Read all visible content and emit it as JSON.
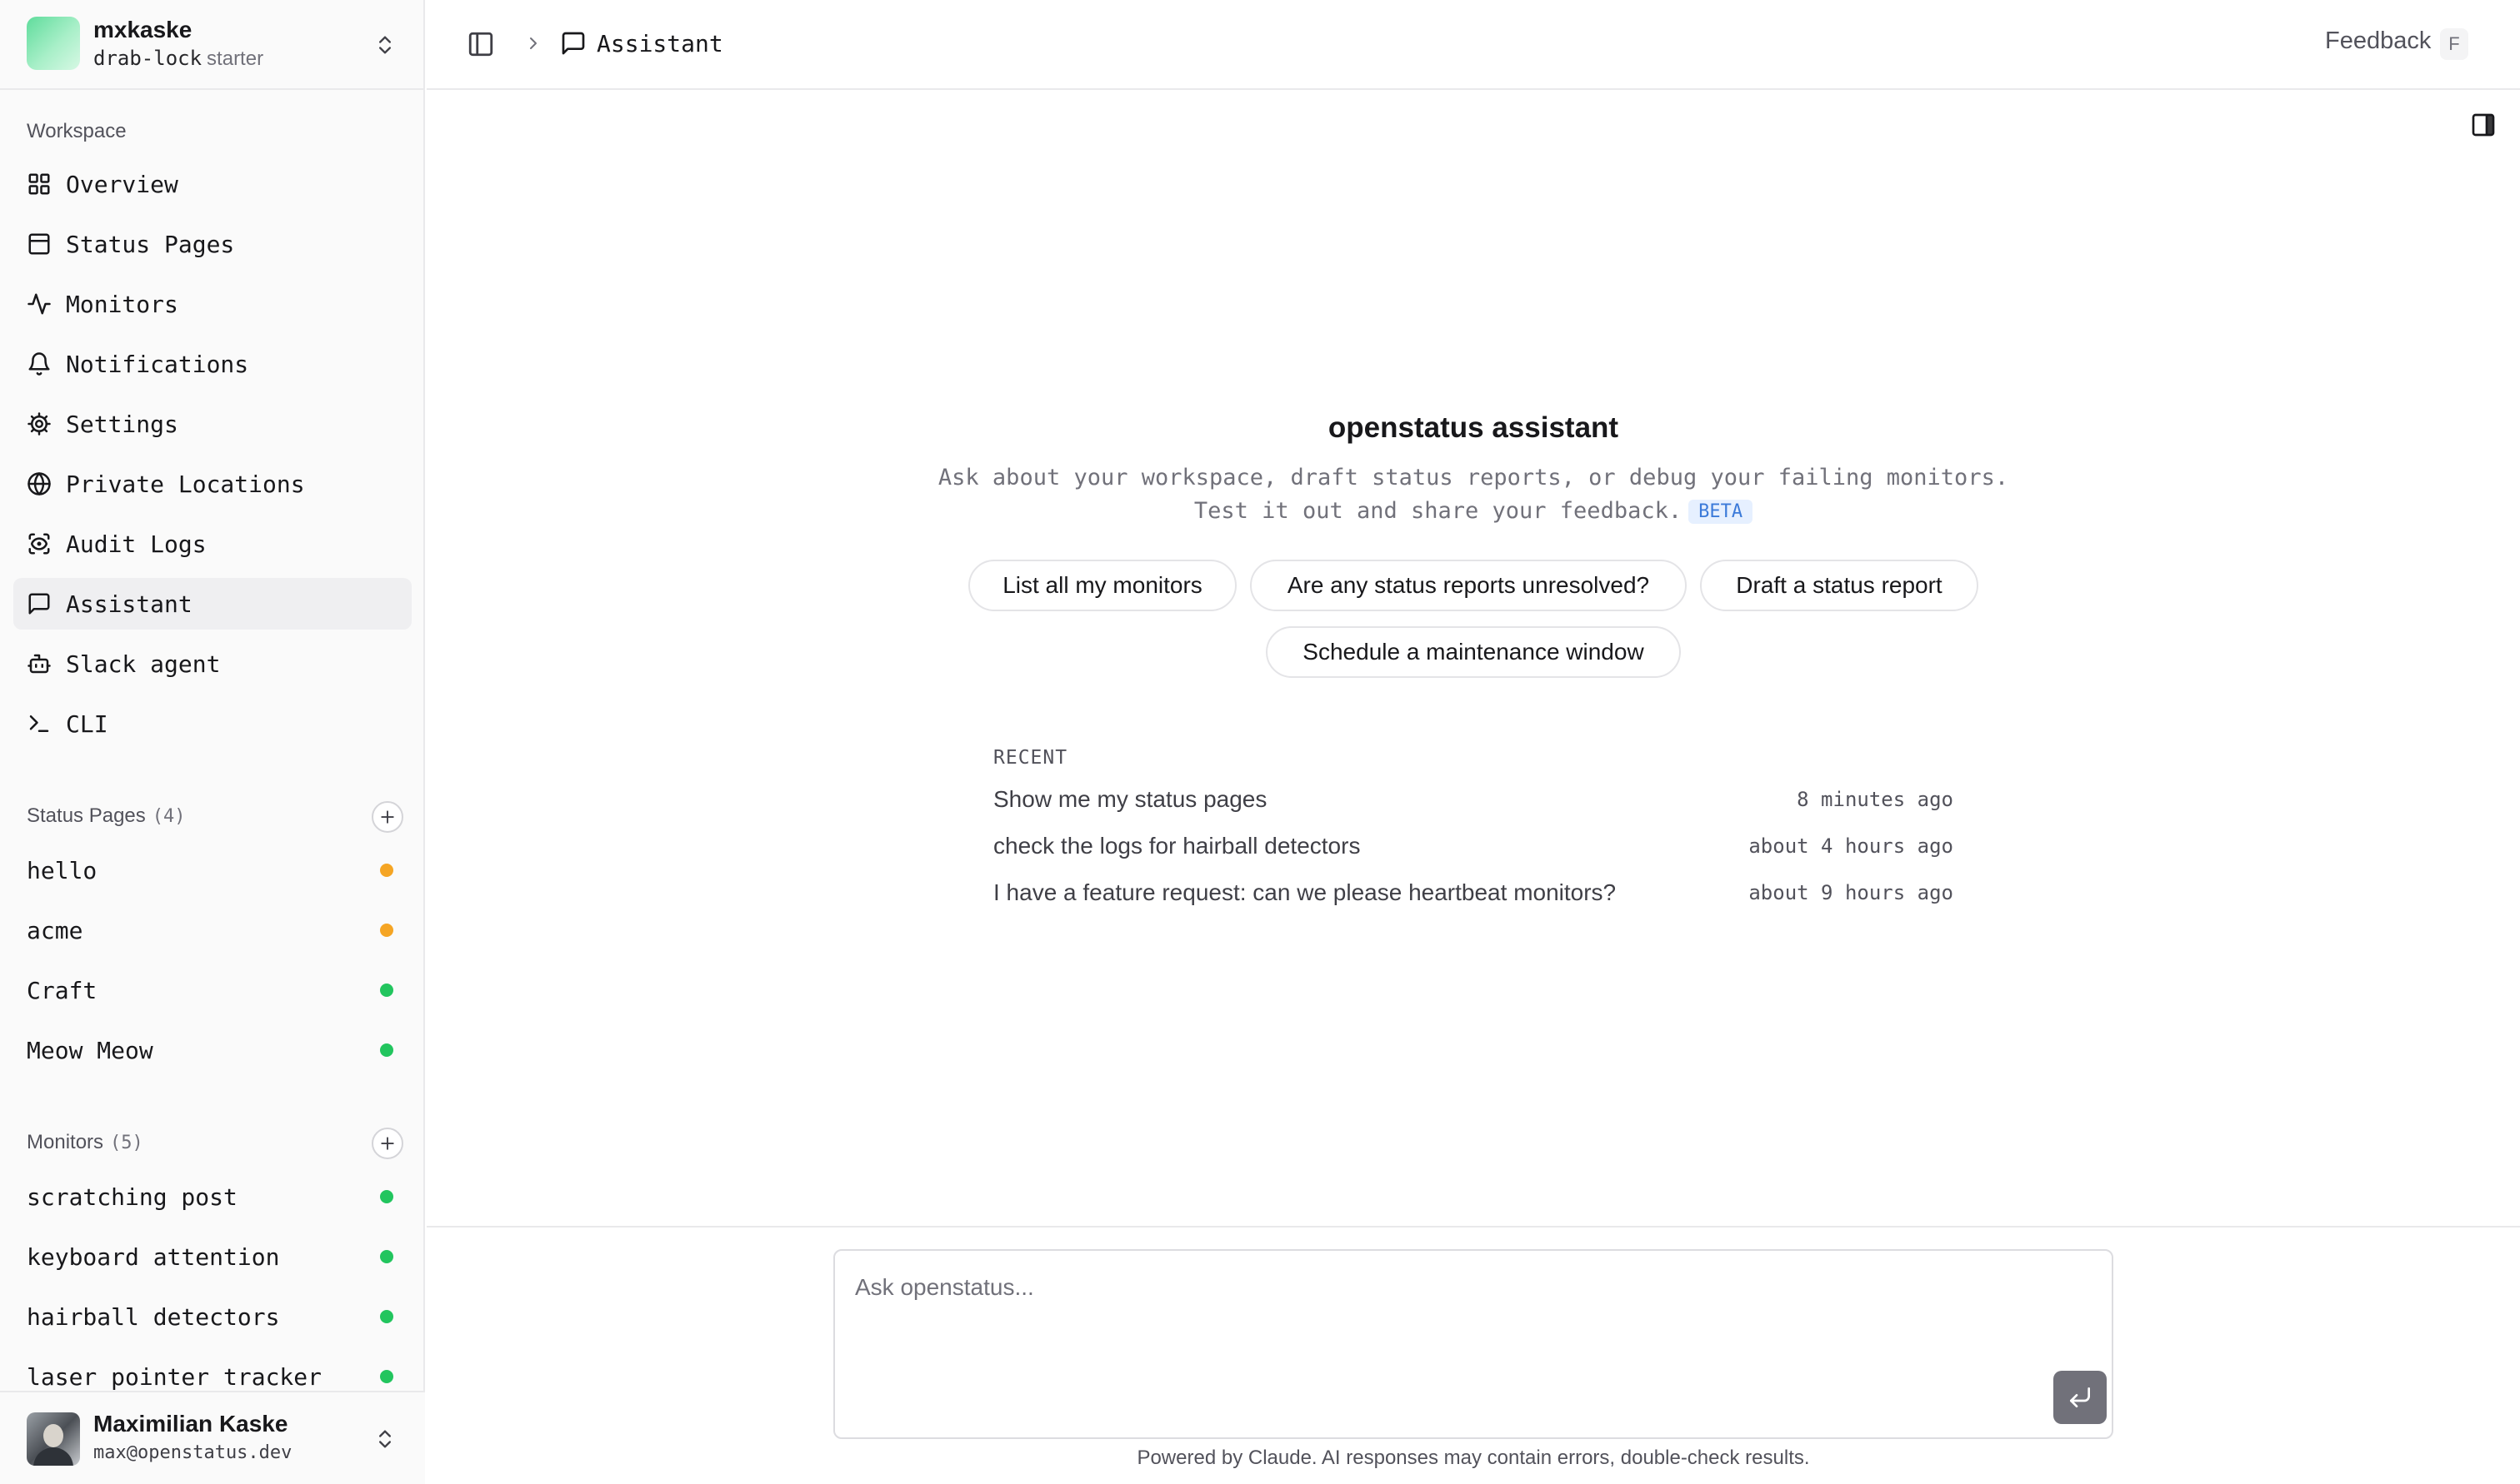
{
  "team": {
    "name": "mxkaske",
    "slug": "drab-lock",
    "plan": "starter"
  },
  "workspace": {
    "label": "Workspace",
    "items": [
      {
        "label": "Overview",
        "icon": "layout-grid-icon"
      },
      {
        "label": "Status Pages",
        "icon": "panel-top-icon"
      },
      {
        "label": "Monitors",
        "icon": "activity-icon"
      },
      {
        "label": "Notifications",
        "icon": "bell-icon"
      },
      {
        "label": "Settings",
        "icon": "cog-icon"
      },
      {
        "label": "Private Locations",
        "icon": "globe-icon"
      },
      {
        "label": "Audit Logs",
        "icon": "scan-eye-icon"
      },
      {
        "label": "Assistant",
        "icon": "message-square-icon",
        "active": true
      },
      {
        "label": "Slack agent",
        "icon": "bot-icon"
      },
      {
        "label": "CLI",
        "icon": "terminal-icon"
      }
    ]
  },
  "status_pages": {
    "label": "Status Pages",
    "count": "(4)",
    "items": [
      {
        "label": "hello",
        "status_color": "#f5a524"
      },
      {
        "label": "acme",
        "status_color": "#f5a524"
      },
      {
        "label": "Craft",
        "status_color": "#22c55e"
      },
      {
        "label": "Meow Meow",
        "status_color": "#22c55e"
      }
    ]
  },
  "monitors": {
    "label": "Monitors",
    "count": "(5)",
    "items": [
      {
        "label": "scratching post",
        "status_color": "#22c55e"
      },
      {
        "label": "keyboard attention",
        "status_color": "#22c55e"
      },
      {
        "label": "hairball detectors",
        "status_color": "#22c55e"
      },
      {
        "label": "laser pointer tracker",
        "status_color": "#22c55e"
      }
    ]
  },
  "user": {
    "name": "Maximilian Kaske",
    "email": "max@openstatus.dev"
  },
  "topbar": {
    "breadcrumb": "Assistant",
    "feedback_label": "Feedback",
    "feedback_shortcut": "F"
  },
  "assistant": {
    "title": "openstatus assistant",
    "subtitle_line1": "Ask about your workspace, draft status reports, or debug your failing monitors.",
    "subtitle_line2": "Test it out and share your feedback.",
    "beta_badge": "BETA",
    "suggestions": [
      "List all my monitors",
      "Are any status reports unresolved?",
      "Draft a status report",
      "Schedule a maintenance window"
    ],
    "recent_label": "RECENT",
    "recent": [
      {
        "title": "Show me my status pages",
        "time": "8 minutes ago"
      },
      {
        "title": "check the logs for hairball detectors",
        "time": "about 4 hours ago"
      },
      {
        "title": "I have a feature request: can we please heartbeat monitors?",
        "time": "about 9 hours ago"
      }
    ]
  },
  "composer": {
    "placeholder": "Ask openstatus...",
    "value": "",
    "footer": "Powered by Claude. AI responses may contain errors, double-check results."
  }
}
